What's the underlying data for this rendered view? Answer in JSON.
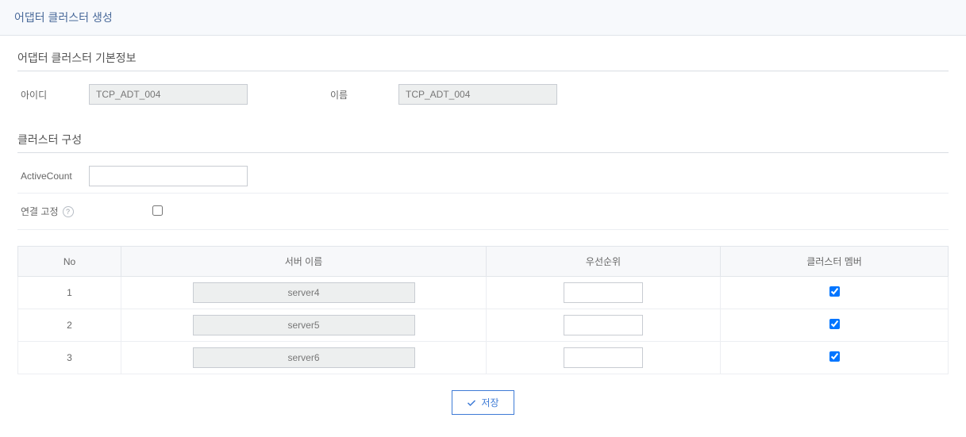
{
  "header": {
    "title": "어댑터 클러스터 생성"
  },
  "basicInfo": {
    "section_title": "어댑터 클러스터 기본정보",
    "id_label": "아이디",
    "id_value": "TCP_ADT_004",
    "name_label": "이름",
    "name_value": "TCP_ADT_004"
  },
  "clusterConfig": {
    "section_title": "클러스터 구성",
    "active_count_label": "ActiveCount",
    "active_count_value": "",
    "fixed_connection_label": "연결 고정",
    "fixed_connection_checked": false
  },
  "table": {
    "columns": {
      "no": "No",
      "server_name": "서버 이름",
      "priority": "우선순위",
      "cluster_member": "클러스터 멤버"
    },
    "rows": [
      {
        "no": "1",
        "server": "server4",
        "priority": "",
        "member": true
      },
      {
        "no": "2",
        "server": "server5",
        "priority": "",
        "member": true
      },
      {
        "no": "3",
        "server": "server6",
        "priority": "",
        "member": true
      }
    ]
  },
  "actions": {
    "save_label": "저장"
  }
}
